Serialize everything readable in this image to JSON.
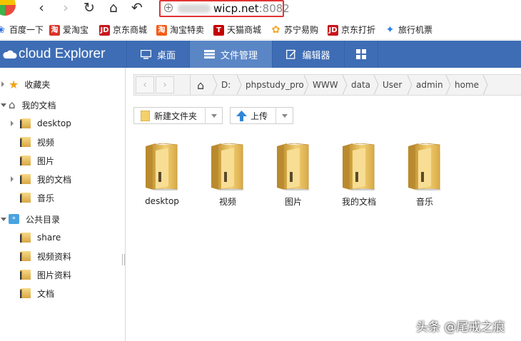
{
  "browser": {
    "url_host": "wicp.net",
    "url_port": ":8082",
    "nav_icons": [
      "back-icon",
      "forward-icon",
      "refresh-icon",
      "home-icon",
      "undo-icon"
    ]
  },
  "bookmarks": [
    {
      "label": "百度一下",
      "icon": "baidu-icon",
      "color": "#2f6fde"
    },
    {
      "label": "爱淘宝",
      "icon": "aitaobao-icon",
      "color": "#d9342b"
    },
    {
      "label": "京东商城",
      "icon": "jd-icon",
      "color": "#c8161d"
    },
    {
      "label": "淘宝特卖",
      "icon": "taobao-icon",
      "color": "#f45c17"
    },
    {
      "label": "天猫商城",
      "icon": "tmall-icon",
      "color": "#c40000"
    },
    {
      "label": "苏宁易购",
      "icon": "suning-icon",
      "color": "#f5a623"
    },
    {
      "label": "京东打折",
      "icon": "jd-icon",
      "color": "#c8161d"
    },
    {
      "label": "旅行机票",
      "icon": "travel-icon",
      "color": "#2b7de0"
    }
  ],
  "app": {
    "logo_text": "cloud Explorer",
    "tabs": [
      {
        "label": "桌面",
        "icon": "monitor-icon",
        "active": false
      },
      {
        "label": "文件管理",
        "icon": "file-manager-icon",
        "active": true
      },
      {
        "label": "编辑器",
        "icon": "editor-icon",
        "active": false
      },
      {
        "label": "",
        "icon": "grid-icon",
        "active": false
      }
    ],
    "header_color": "#3e6db5"
  },
  "sidebar": {
    "favorites": "收藏夹",
    "my_docs": "我的文档",
    "my_docs_children": [
      "desktop",
      "视频",
      "图片",
      "我的文档",
      "音乐"
    ],
    "public": "公共目录",
    "public_children": [
      "share",
      "视频资料",
      "图片资料",
      "文档"
    ]
  },
  "path": {
    "crumbs": [
      "D:",
      "phpstudy_pro",
      "WWW",
      "data",
      "User",
      "admin",
      "home"
    ]
  },
  "actions": {
    "new_folder": "新建文件夹",
    "upload": "上传"
  },
  "folders": [
    "desktop",
    "视频",
    "图片",
    "我的文档",
    "音乐"
  ],
  "watermark": "头条 @尾戒之痕"
}
